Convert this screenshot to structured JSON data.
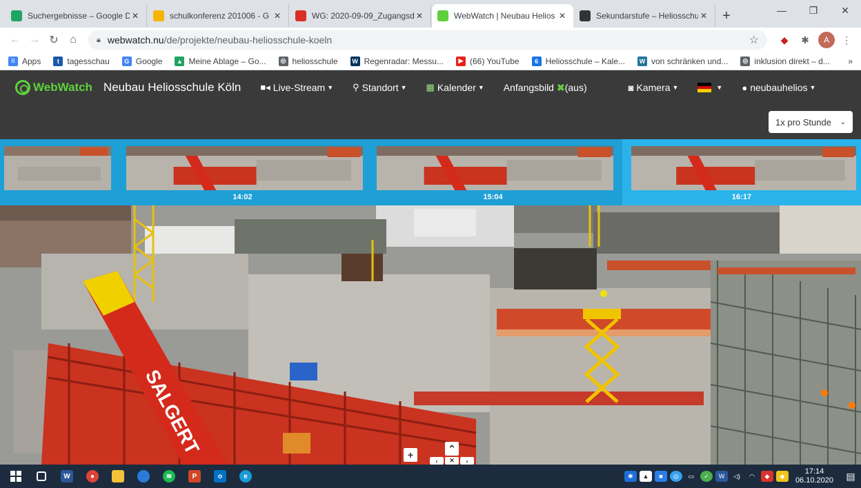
{
  "browser": {
    "tabs": [
      {
        "title": "Suchergebnisse – Google D",
        "icon": "google-drive-icon",
        "color": "#1fa463",
        "active": false
      },
      {
        "title": "schulkonferenz 201006 - G",
        "icon": "google-slides-icon",
        "color": "#f4b400",
        "active": false
      },
      {
        "title": "WG: 2020-09-09_Zugangsd",
        "icon": "gmail-icon",
        "color": "#d93025",
        "active": false
      },
      {
        "title": "WebWatch | Neubau Helios",
        "icon": "webwatch-icon",
        "color": "#5fcf3d",
        "active": true
      },
      {
        "title": "Sekundarstufe – Heliosschu",
        "icon": "site-e-icon",
        "color": "#333333",
        "active": false
      }
    ],
    "new_tab": "+",
    "window_controls": {
      "minimize": "—",
      "restore": "❐",
      "close": "✕"
    },
    "url_host": "webwatch.nu",
    "url_path": "/de/projekte/neubau-heliosschule-koeln",
    "avatar_letter": "A",
    "bookmarks": [
      {
        "label": "Apps",
        "icon": "apps-grid-icon",
        "color": "#4285f4",
        "glyph": "⁝⁝"
      },
      {
        "label": "tagesschau",
        "icon": "tagesschau-icon",
        "color": "#1a5aa7",
        "glyph": "t"
      },
      {
        "label": "Google",
        "icon": "google-icon",
        "color": "#4285f4",
        "glyph": "G"
      },
      {
        "label": "Meine Ablage – Go...",
        "icon": "google-drive-icon",
        "color": "#1fa463",
        "glyph": "▲"
      },
      {
        "label": "heliosschule",
        "icon": "globe-icon",
        "color": "#5f6368",
        "glyph": "◎"
      },
      {
        "label": "Regenradar: Messu...",
        "icon": "wdr-icon",
        "color": "#00345e",
        "glyph": "W"
      },
      {
        "label": "(66) YouTube",
        "icon": "youtube-icon",
        "color": "#e62117",
        "glyph": "▶"
      },
      {
        "label": "Heliosschule – Kale...",
        "icon": "calendar-icon",
        "color": "#1a73e8",
        "glyph": "6"
      },
      {
        "label": "von schränken und...",
        "icon": "wordpress-icon",
        "color": "#21759b",
        "glyph": "W"
      },
      {
        "label": "inklusion direkt – d...",
        "icon": "globe-icon",
        "color": "#5f6368",
        "glyph": "◎"
      }
    ],
    "bookmarks_more": "»"
  },
  "site": {
    "brand": "WebWatch",
    "title": "Neubau Heliosschule Köln",
    "nav": {
      "livestream": "Live-Stream",
      "standort": "Standort",
      "kalender": "Kalender",
      "anfangsbild": "Anfangsbild",
      "anfangsbild_state": "(aus)",
      "kamera": "Kamera",
      "user": "neubauhelios"
    },
    "frequency_select": "1x pro Stunde",
    "thumbnails": [
      {
        "time": "14:02"
      },
      {
        "time": "15:04"
      },
      {
        "time": "16:17"
      }
    ],
    "crane_text": "SALGERT"
  },
  "taskbar": {
    "time": "17:14",
    "date": "06.10.2020"
  },
  "colors": {
    "nav_bg": "#3a3a3a",
    "brand_green": "#5fcf3d",
    "thumb_strip": "#1e9fd6",
    "taskbar": "#1c2c3e"
  }
}
